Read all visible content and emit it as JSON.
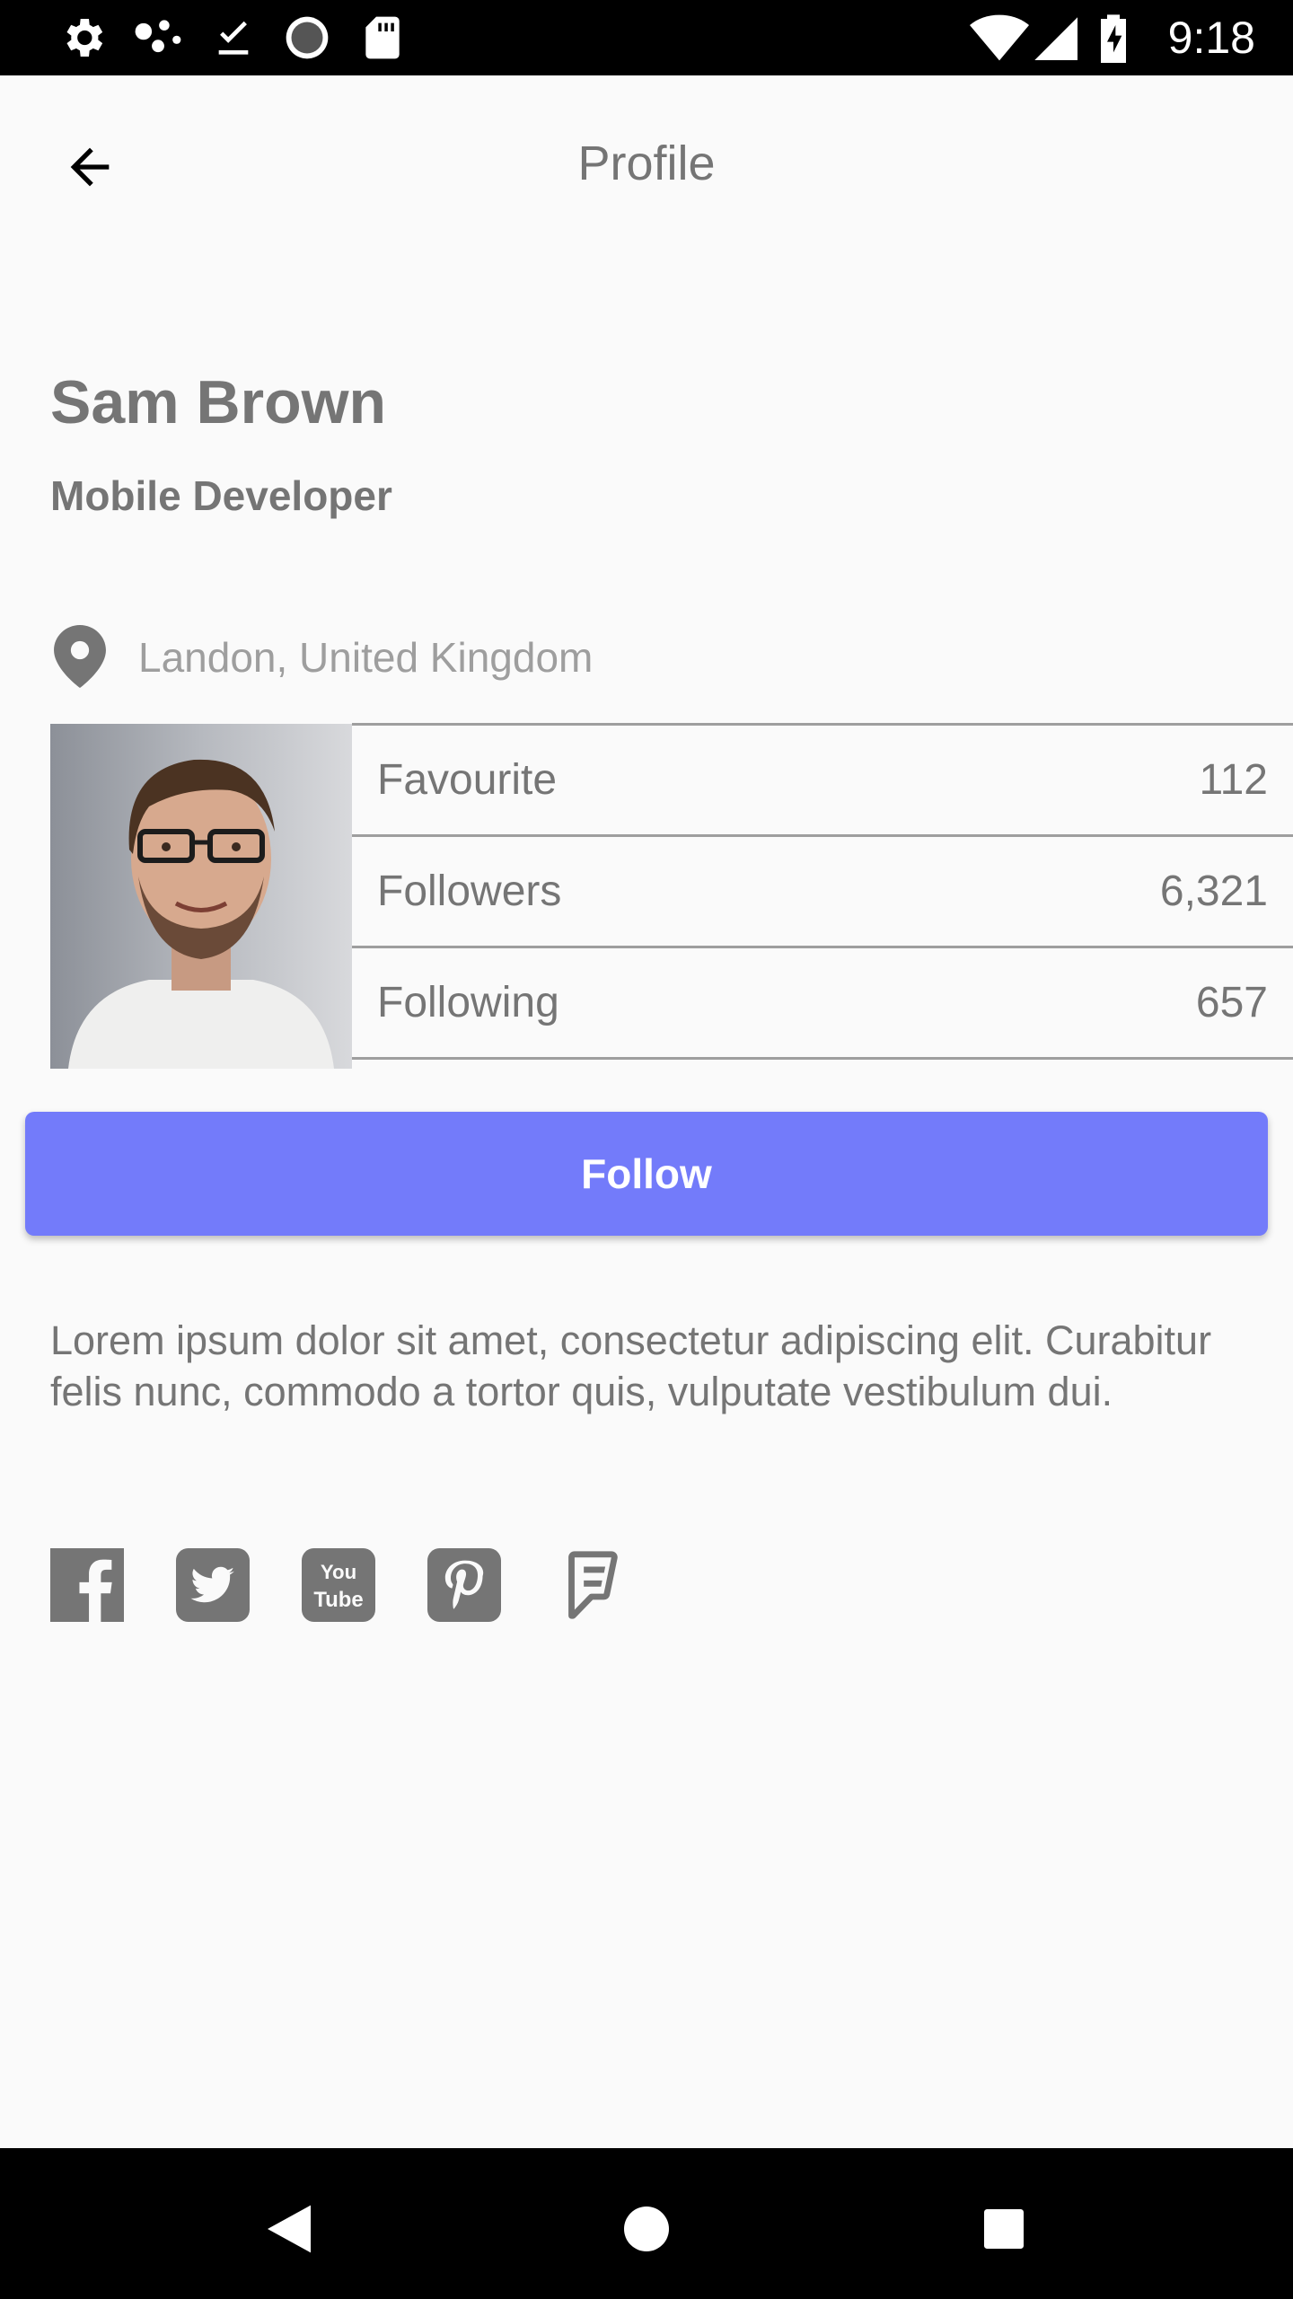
{
  "status_bar": {
    "time": "9:18",
    "left_icons": [
      "gear-icon",
      "dots-icon",
      "download-done-icon",
      "progress-icon",
      "sd-card-icon"
    ],
    "right_icons": [
      "wifi-icon",
      "signal-icon",
      "battery-charging-icon"
    ]
  },
  "app_bar": {
    "title": "Profile",
    "back_icon": "arrow-back-icon"
  },
  "profile": {
    "name": "Sam Brown",
    "role": "Mobile Developer",
    "location": "Landon, United Kingdom",
    "location_icon": "location-pin-icon"
  },
  "stats": [
    {
      "label": "Favourite",
      "value": "112"
    },
    {
      "label": "Followers",
      "value": "6,321"
    },
    {
      "label": "Following",
      "value": "657"
    }
  ],
  "follow_button": {
    "label": "Follow",
    "color": "#737bfa"
  },
  "bio": "Lorem ipsum dolor sit amet, consectetur adipiscing elit. Curabitur felis nunc, commodo a tortor quis, vulputate vestibulum dui.",
  "social_icons": [
    "facebook-icon",
    "twitter-icon",
    "youtube-icon",
    "pinterest-icon",
    "foursquare-icon"
  ],
  "nav_bar": {
    "buttons": [
      "back-triangle-icon",
      "home-circle-icon",
      "recents-square-icon"
    ]
  },
  "colors": {
    "background": "#fafafa",
    "text_gray": "#757575",
    "accent": "#737bfa"
  }
}
